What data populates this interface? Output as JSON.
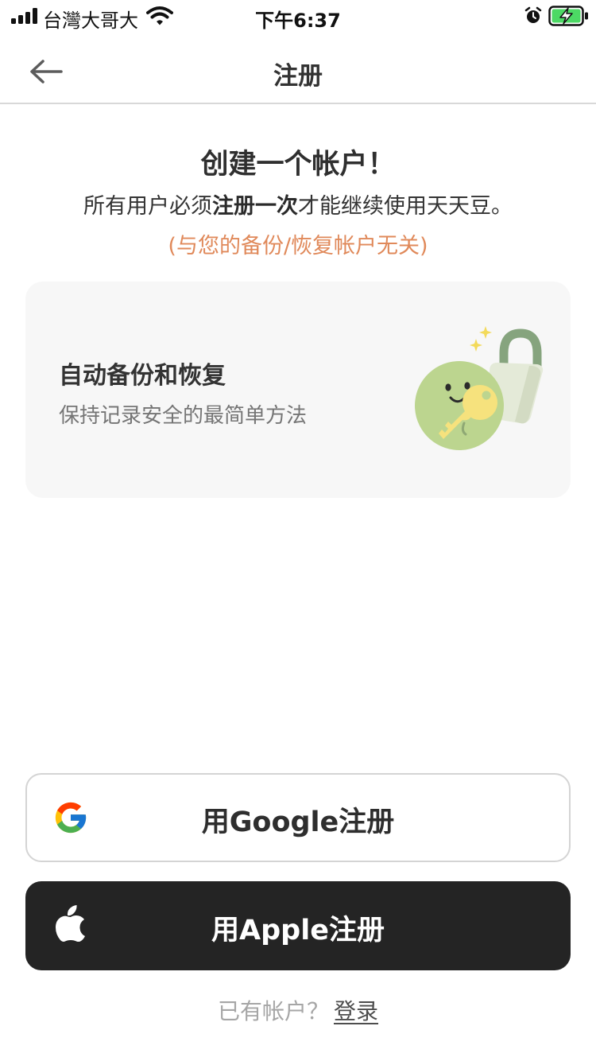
{
  "status_bar": {
    "carrier": "台灣大哥大",
    "time": "下午6:37",
    "icons": [
      "signal-icon",
      "wifi-icon",
      "alarm-icon",
      "battery-charging-icon"
    ]
  },
  "nav": {
    "title": "注册",
    "back_icon": "arrow-left-icon"
  },
  "intro": {
    "heading": "创建一个帐户！",
    "sub_prefix": "所有用户必须",
    "sub_bold": "注册一次",
    "sub_suffix": "才能继续使用天天豆。",
    "note": "(与您的备份/恢复帐户无关)"
  },
  "card": {
    "title": "自动备份和恢复",
    "description": "保持记录安全的最简单方法",
    "illustration": "lock-key-bean-illustration"
  },
  "buttons": {
    "google_label": "用Google注册",
    "google_icon": "google-icon",
    "apple_label": "用Apple注册",
    "apple_icon": "apple-icon"
  },
  "footer": {
    "question": "已有帐户？",
    "login_link": "登录"
  },
  "colors": {
    "accent_note": "#e0895a",
    "apple_button_bg": "#242424",
    "card_bg": "#f7f7f7",
    "bean_green": "#bcd58f",
    "lock_green": "#86a47e",
    "key_yellow": "#f6e27d"
  }
}
